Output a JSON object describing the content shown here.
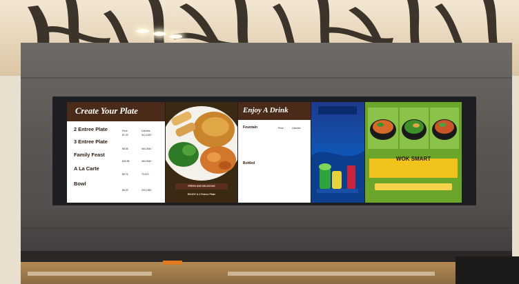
{
  "create_panel": {
    "title": "Create Your Plate",
    "col_price": "Price",
    "col_calories": "Calories",
    "items": [
      {
        "name": "2 Entree Plate",
        "price": "$7.29",
        "calories": "310-1490"
      },
      {
        "name": "3 Entree Plate",
        "price": "$8.58",
        "calories": "460-2640"
      },
      {
        "name": "Family Feast",
        "price": "$30.98",
        "calories": "460-2640"
      },
      {
        "name": "A La Carte",
        "price": "$5.75",
        "calories": "70-570"
      },
      {
        "name": "Bowl",
        "price": "$6.29",
        "calories": "200-1360"
      }
    ]
  },
  "food_panel": {
    "banner": "FRESH AND DELICIOUS",
    "caption": "ENJOY A 2 Entree Plate"
  },
  "drink_panel": {
    "title": "Enjoy A Drink",
    "section_fountain": "Fountain",
    "section_bottled": "Bottled",
    "col_price": "Price",
    "col_calories": "Calories"
  },
  "wok_panel": {
    "logo": "WOK SMART"
  },
  "icons": {
    "lights": "ceiling-light-icon",
    "leaves": "bamboo-leaf-screen"
  },
  "colors": {
    "menu_header_brown": "#4a2b19",
    "wok_green": "#6ba62b",
    "wok_yellow": "#f2c21d",
    "wall_gray": "#5a5653"
  }
}
